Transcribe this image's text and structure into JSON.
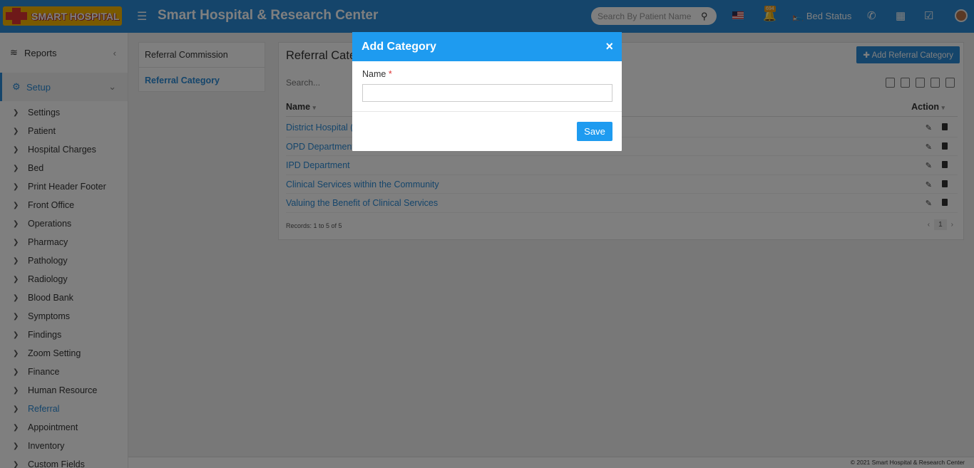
{
  "header": {
    "logo_text": "SMART HOSPITAL",
    "app_title": "Smart Hospital & Research Center",
    "search_placeholder": "Search By Patient Name",
    "notification_count": "694",
    "bed_status_label": "Bed Status",
    "menu_icon": "hamburger-icon"
  },
  "sidebar": {
    "reports_label": "Reports",
    "setup_label": "Setup",
    "items": [
      {
        "label": "Settings"
      },
      {
        "label": "Patient"
      },
      {
        "label": "Hospital Charges"
      },
      {
        "label": "Bed"
      },
      {
        "label": "Print Header Footer"
      },
      {
        "label": "Front Office"
      },
      {
        "label": "Operations"
      },
      {
        "label": "Pharmacy"
      },
      {
        "label": "Pathology"
      },
      {
        "label": "Radiology"
      },
      {
        "label": "Blood Bank"
      },
      {
        "label": "Symptoms"
      },
      {
        "label": "Findings"
      },
      {
        "label": "Zoom Setting"
      },
      {
        "label": "Finance"
      },
      {
        "label": "Human Resource"
      },
      {
        "label": "Referral"
      },
      {
        "label": "Appointment"
      },
      {
        "label": "Inventory"
      },
      {
        "label": "Custom Fields"
      }
    ],
    "active_item": "Referral"
  },
  "subnav": {
    "items": [
      "Referral Commission",
      "Referral Category"
    ],
    "active": "Referral Category"
  },
  "panel": {
    "title": "Referral Category",
    "add_button": "Add Referral Category",
    "search_placeholder": "Search...",
    "columns": [
      "Name",
      "Action"
    ],
    "rows": [
      {
        "name": "District Hospital (DH)"
      },
      {
        "name": "OPD Department"
      },
      {
        "name": "IPD Department"
      },
      {
        "name": "Clinical Services within the Community"
      },
      {
        "name": "Valuing the Benefit of Clinical Services"
      }
    ],
    "records_text": "Records: 1 to 5 of 5",
    "current_page": "1"
  },
  "footer": {
    "copyright": "© 2021 Smart Hospital & Research Center"
  },
  "modal": {
    "title": "Add Category",
    "close_symbol": "×",
    "name_label": "Name",
    "required_mark": "*",
    "name_value": "",
    "save_label": "Save"
  },
  "colors": {
    "primary": "#2a8bd6",
    "modal_header": "#1e9bf0",
    "logo": "#f4b400"
  }
}
